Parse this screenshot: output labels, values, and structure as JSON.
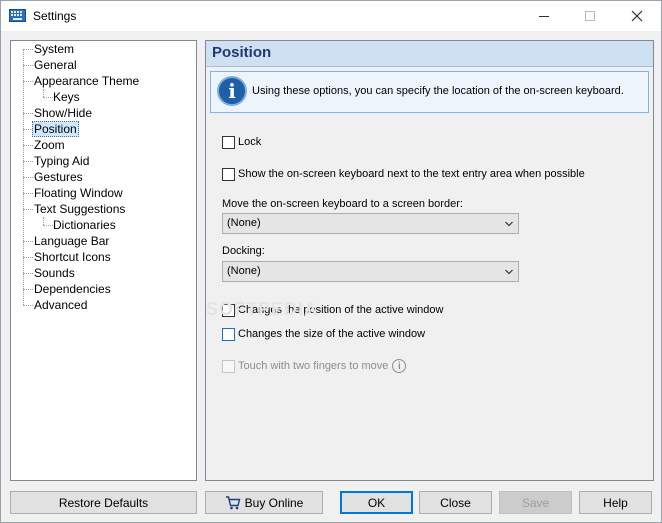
{
  "window": {
    "title": "Settings",
    "app_icon": "keyboard-icon"
  },
  "tree": {
    "items": [
      {
        "label": "System",
        "level": 0
      },
      {
        "label": "General",
        "level": 0
      },
      {
        "label": "Appearance Theme",
        "level": 0
      },
      {
        "label": "Keys",
        "level": 1
      },
      {
        "label": "Show/Hide",
        "level": 0
      },
      {
        "label": "Position",
        "level": 0,
        "selected": true
      },
      {
        "label": "Zoom",
        "level": 0
      },
      {
        "label": "Typing Aid",
        "level": 0
      },
      {
        "label": "Gestures",
        "level": 0
      },
      {
        "label": "Floating Window",
        "level": 0
      },
      {
        "label": "Text Suggestions",
        "level": 0
      },
      {
        "label": "Dictionaries",
        "level": 1
      },
      {
        "label": "Language Bar",
        "level": 0
      },
      {
        "label": "Shortcut Icons",
        "level": 0
      },
      {
        "label": "Sounds",
        "level": 0
      },
      {
        "label": "Dependencies",
        "level": 0
      },
      {
        "label": "Advanced",
        "level": 0
      }
    ]
  },
  "panel": {
    "title": "Position",
    "info_text": "Using these options, you can specify the location of the on-screen keyboard.",
    "lock_label": "Lock",
    "show_next_label": "Show the on-screen keyboard next to the text entry area when possible",
    "border_label": "Move the on-screen keyboard to a screen border:",
    "border_value": "(None)",
    "docking_label": "Docking:",
    "docking_value": "(None)",
    "changes_position_label": "Changes the position of the active window",
    "changes_size_label": "Changes the size of the active window",
    "touch_label": "Touch with two fingers to move",
    "watermark": "SOFTPEDIA"
  },
  "buttons": {
    "restore": "Restore Defaults",
    "buy": "Buy Online",
    "ok": "OK",
    "close": "Close",
    "save": "Save",
    "help": "Help"
  },
  "colors": {
    "accent": "#0078d7",
    "header_bg": "#cfe0f3",
    "selection": "#cce8ff"
  }
}
